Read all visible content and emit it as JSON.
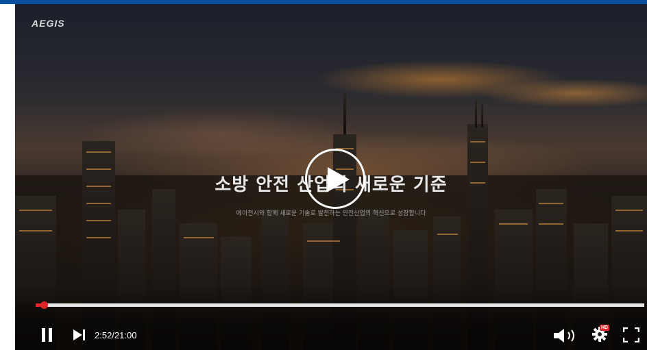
{
  "header": {
    "brand_color": "#0a4fa0"
  },
  "video": {
    "logo": "AEGIS",
    "headline": "소방 안전 산업의 새로운 기준",
    "subline": "에이전시와 함께 새로운 기술로 발전하는 안전산업의 혁신으로 성장합니다"
  },
  "controls": {
    "current_time": "2:52/21:00",
    "progress_fraction": 0.0137,
    "hd_label": "HD",
    "accent_color": "#e0262a"
  },
  "icons": [
    "play-icon",
    "pause-icon",
    "skip-next-icon",
    "volume-icon",
    "gear-icon",
    "fullscreen-icon"
  ]
}
